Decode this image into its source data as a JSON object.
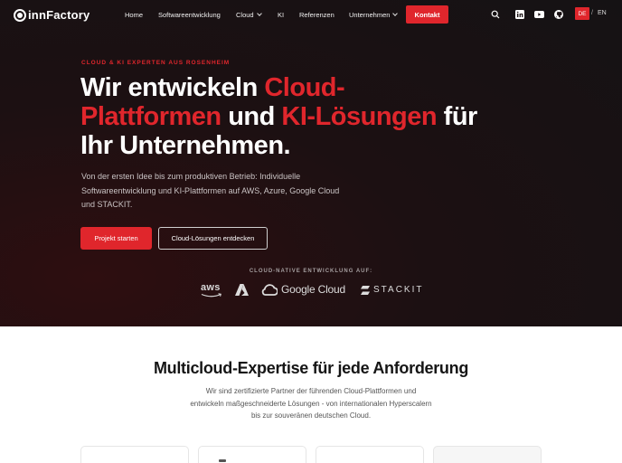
{
  "brand": {
    "name": "innFactory"
  },
  "nav": {
    "items": [
      {
        "label": "Home",
        "has_dropdown": false
      },
      {
        "label": "Softwareentwicklung",
        "has_dropdown": false
      },
      {
        "label": "Cloud",
        "has_dropdown": true
      },
      {
        "label": "KI",
        "has_dropdown": false
      },
      {
        "label": "Referenzen",
        "has_dropdown": false
      },
      {
        "label": "Unternehmen",
        "has_dropdown": true
      }
    ],
    "cta_label": "Kontakt",
    "icons": [
      "search-icon",
      "linkedin-icon",
      "youtube-icon",
      "github-icon"
    ],
    "lang_active": "DE",
    "lang_separator": "/",
    "lang_other": "EN"
  },
  "hero": {
    "eyebrow": "CLOUD & KI EXPERTEN AUS ROSENHEIM",
    "headline_part1": "Wir entwickeln ",
    "headline_red1": "Cloud-Plattformen",
    "headline_part2": " und ",
    "headline_red2": "KI-Lösungen",
    "headline_part3": " für Ihr Unternehmen.",
    "subtext": "Von der ersten Idee bis zum produktiven Betrieb: Individuelle Softwareentwicklung und KI-Plattformen auf AWS, Azure, Google Cloud und STACKIT.",
    "primary_button": "Projekt starten",
    "secondary_button": "Cloud-Lösungen entdecken",
    "cloud_caption": "CLOUD-NATIVE ENTWICKLUNG AUF:",
    "partners": {
      "aws": "aws",
      "azure": "azure-logo",
      "google": "Google Cloud",
      "stackit": "STACKIT"
    }
  },
  "section2": {
    "title": "Multicloud-Expertise für jede Anforderung",
    "text": "Wir sind zertifizierte Partner der führenden Cloud-Plattformen und entwickeln maßgeschneiderte Lösungen - von internationalen Hyperscalern bis zur souveränen deutschen Cloud."
  },
  "colors": {
    "accent": "#e0262c",
    "hero_bg": "#151214",
    "text_dark": "#151515"
  }
}
